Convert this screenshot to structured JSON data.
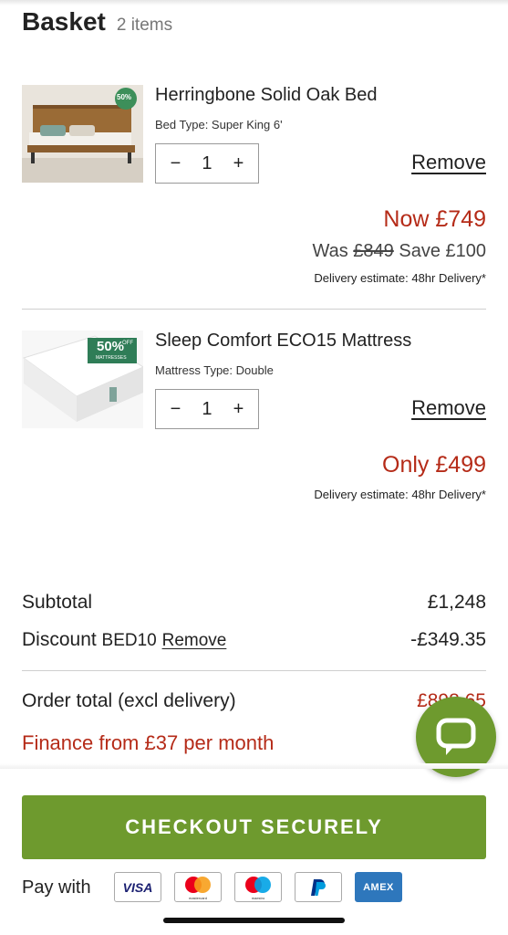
{
  "header": {
    "title": "Basket",
    "count": "2 items"
  },
  "items": [
    {
      "name": "Herringbone Solid Oak Bed",
      "variant": "Bed Type: Super King 6'",
      "quantity": "1",
      "minus": "−",
      "plus": "+",
      "remove_label": "Remove",
      "price_now": "Now £749",
      "was_label": "Was",
      "was_price": "£849",
      "save_label": "Save £100",
      "delivery": "Delivery estimate: 48hr Delivery*",
      "badge": "50%",
      "icon": "bed-thumbnail"
    },
    {
      "name": "Sleep Comfort ECO15 Mattress",
      "variant": "Mattress Type: Double",
      "quantity": "1",
      "minus": "−",
      "plus": "+",
      "remove_label": "Remove",
      "price_now": "Only £499",
      "delivery": "Delivery estimate: 48hr Delivery*",
      "badge": "50%",
      "badge_sub": "OFF",
      "badge_sub2": "MATTRESSES",
      "icon": "mattress-thumbnail"
    }
  ],
  "summary": {
    "subtotal_label": "Subtotal",
    "subtotal_value": "£1,248",
    "discount_label": "Discount",
    "discount_code": "BED10",
    "discount_remove": "Remove",
    "discount_value": "-£349.35",
    "order_total_label": "Order total",
    "order_total_note": "(excl delivery)",
    "order_total_value": "£898.65",
    "finance": "Finance from £37 per month"
  },
  "checkout": {
    "label": "CHECKOUT SECURELY"
  },
  "payment": {
    "label": "Pay with",
    "methods": [
      "VISA",
      "mastercard",
      "maestro",
      "PayPal",
      "AMEX"
    ]
  },
  "colors": {
    "accent": "#6e9a2e",
    "price": "#b52b18"
  },
  "chat": {
    "icon": "chat-bubble-icon"
  }
}
